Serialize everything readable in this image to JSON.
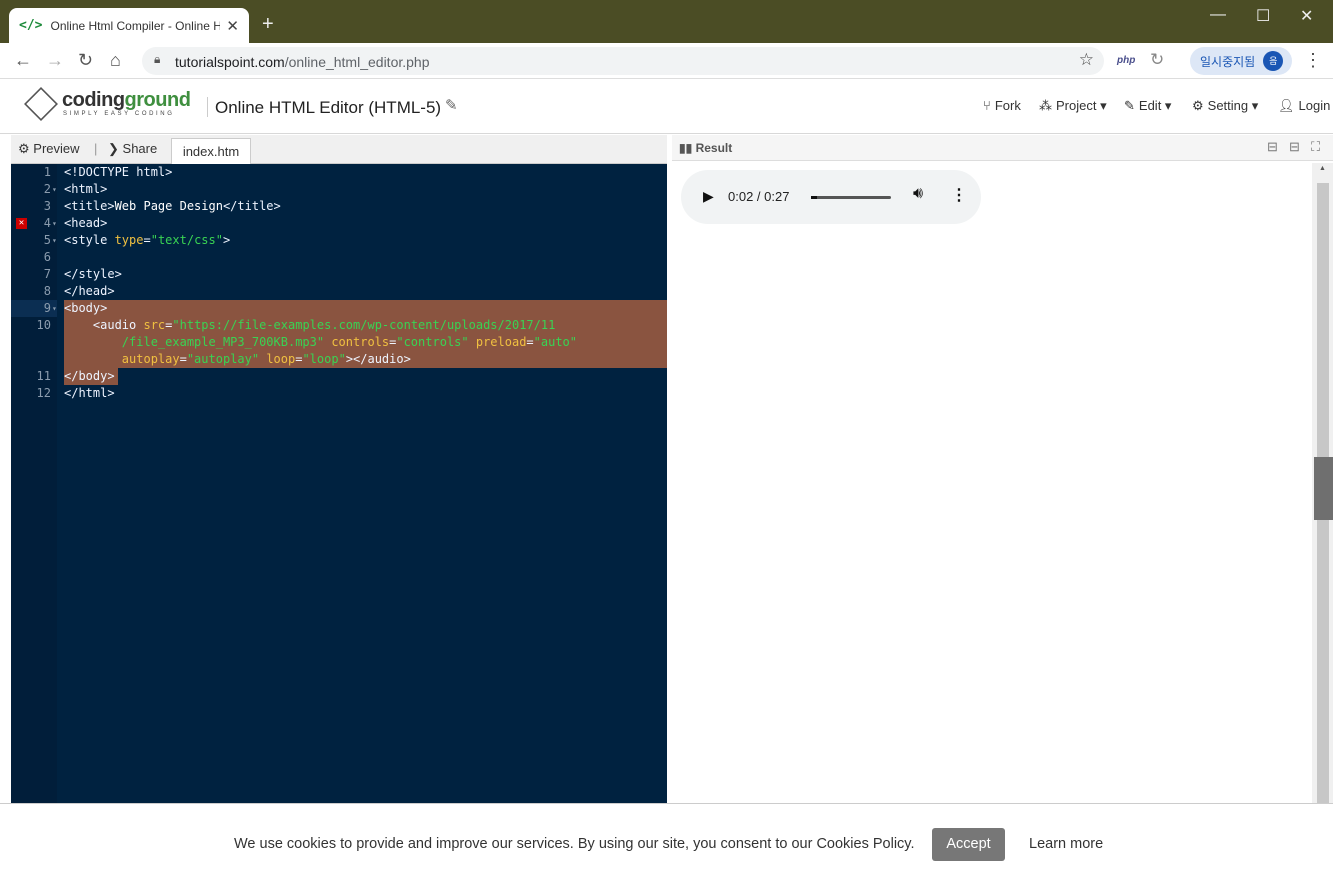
{
  "browser": {
    "tab_title": "Online Html Compiler - Online H",
    "tab_favicon": "</>",
    "url_domain": "tutorialspoint.com",
    "url_path": "/online_html_editor.php",
    "profile_label": "일시중지됨",
    "profile_initial": "음",
    "ext_php": "php"
  },
  "site": {
    "logo_part1": "coding",
    "logo_part2": "ground",
    "logo_tagline": "SIMPLY EASY CODING",
    "editor_title": "Online HTML Editor (HTML-5)",
    "menu": {
      "fork": "Fork",
      "project": "Project",
      "edit": "Edit",
      "setting": "Setting",
      "login": "Login"
    }
  },
  "editor": {
    "preview_label": "Preview",
    "share_label": "Share",
    "file_tab": "index.htm",
    "line_numbers": [
      "1",
      "2",
      "3",
      "4",
      "5",
      "6",
      "7",
      "8",
      "9",
      "10",
      "11",
      "12"
    ]
  },
  "result": {
    "title": "Result",
    "audio_time": "0:02 / 0:27",
    "audio_progress": 0.07
  },
  "cookie": {
    "message": "We use cookies to provide and improve our services. By using our site, you consent to our Cookies Policy.",
    "accept_label": "Accept",
    "learn_more_label": "Learn more"
  },
  "colors": {
    "titlebar": "#4b4d25",
    "editor_bg": "#002240",
    "selection": "#8a5440",
    "accent_green": "#3f8f3f"
  }
}
